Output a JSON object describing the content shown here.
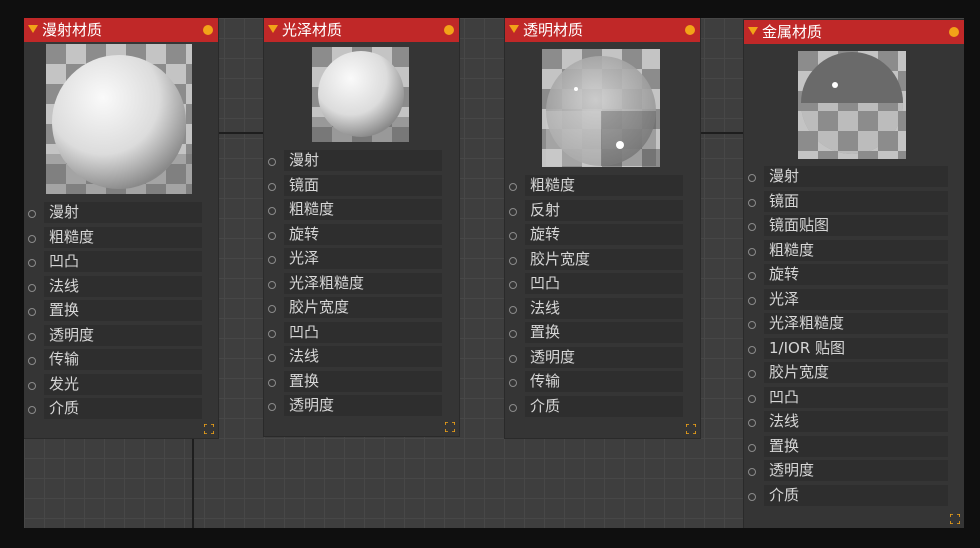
{
  "nodes": [
    {
      "title": "漫射材质",
      "ports": [
        "漫射",
        "粗糙度",
        "凹凸",
        "法线",
        "置换",
        "透明度",
        "传输",
        "发光",
        "介质"
      ]
    },
    {
      "title": "光泽材质",
      "ports": [
        "漫射",
        "镜面",
        "粗糙度",
        "旋转",
        "光泽",
        "光泽粗糙度",
        "胶片宽度",
        "凹凸",
        "法线",
        "置换",
        "透明度"
      ]
    },
    {
      "title": "透明材质",
      "ports": [
        "粗糙度",
        "反射",
        "旋转",
        "胶片宽度",
        "凹凸",
        "法线",
        "置换",
        "透明度",
        "传输",
        "介质"
      ]
    },
    {
      "title": "金属材质",
      "ports": [
        "漫射",
        "镜面",
        "镜面贴图",
        "粗糙度",
        "旋转",
        "光泽",
        "光泽粗糙度",
        "1/IOR 贴图",
        "胶片宽度",
        "凹凸",
        "法线",
        "置换",
        "透明度",
        "介质"
      ]
    }
  ],
  "colors": {
    "header": "#c02828",
    "accent": "#f2a318",
    "node_body": "#353535",
    "port_label_bg": "#2e2e2e",
    "canvas": "#3e3e3e"
  },
  "icons": {
    "collapse": "triangle-down-icon",
    "status": "status-dot-icon",
    "expand": "expand-icon"
  }
}
